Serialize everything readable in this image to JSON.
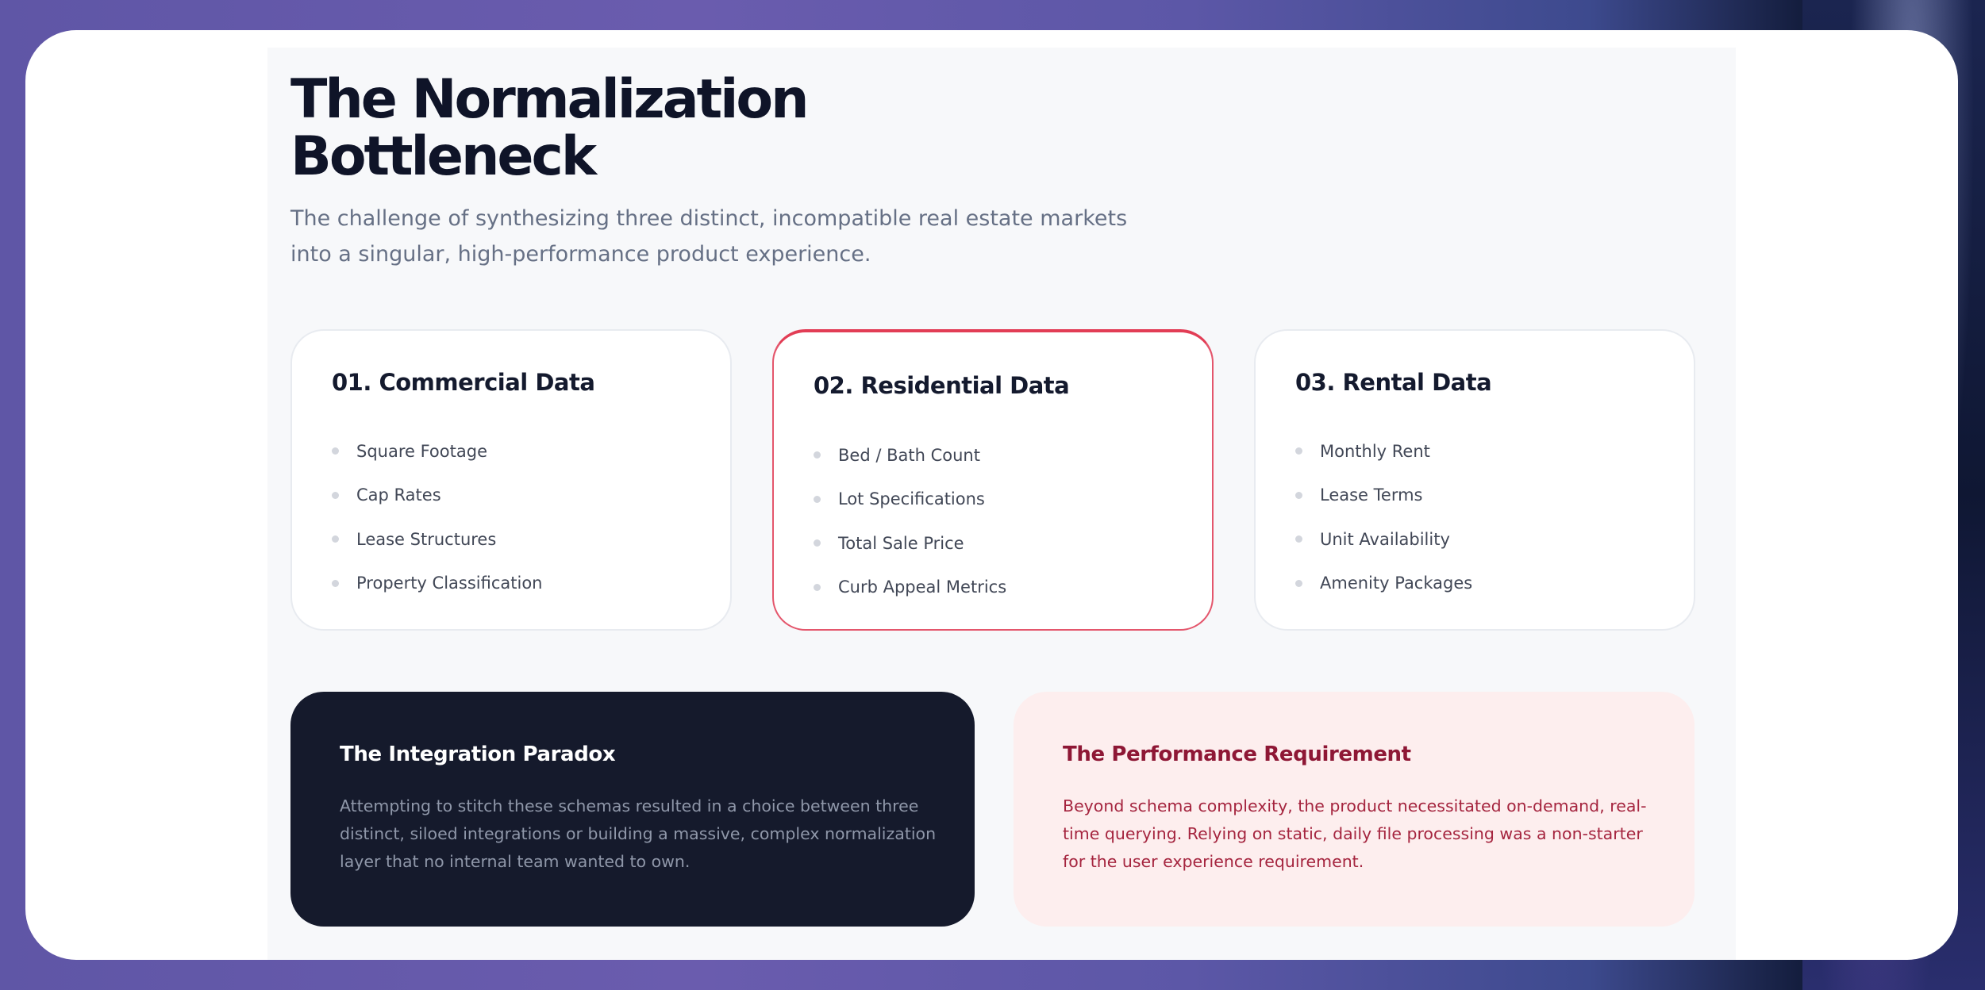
{
  "page": {
    "title_lines": [
      "The Normalization",
      "Bottleneck"
    ],
    "subtitle_lines": [
      "The challenge of synthesizing three distinct, incompatible real estate markets",
      "into a singular, high-performance product experience."
    ]
  },
  "cards": [
    {
      "title": "01. Commercial Data",
      "items": [
        "Square Footage",
        "Cap Rates",
        "Lease Structures",
        "Property Classification"
      ]
    },
    {
      "title": "02. Residential Data",
      "items": [
        "Bed / Bath Count",
        "Lot Specifications",
        "Total Sale Price",
        "Curb Appeal Metrics"
      ],
      "highlighted": true,
      "accent_color": "#e23d55"
    },
    {
      "title": "03. Rental Data",
      "items": [
        "Monthly Rent",
        "Lease Terms",
        "Unit Availability",
        "Amenity Packages"
      ]
    }
  ],
  "panels": {
    "integration": {
      "title": "The Integration Paradox",
      "body_lines": [
        "Attempting to stitch these schemas resulted in a choice between three",
        "distinct, siloed integrations or building a massive, complex normalization",
        "layer that no internal team wanted to own."
      ],
      "background": "#151a2c"
    },
    "performance": {
      "title": "The Performance Requirement",
      "body_lines": [
        "Beyond schema complexity, the product necessitated on-demand, real-",
        "time querying. Relying on static, daily file processing was a non-starter",
        "for the user experience requirement."
      ],
      "background": "#fdeeee",
      "accent_color": "#8e1735"
    }
  },
  "icons": {
    "bullet": "bullet-dot-icon"
  }
}
